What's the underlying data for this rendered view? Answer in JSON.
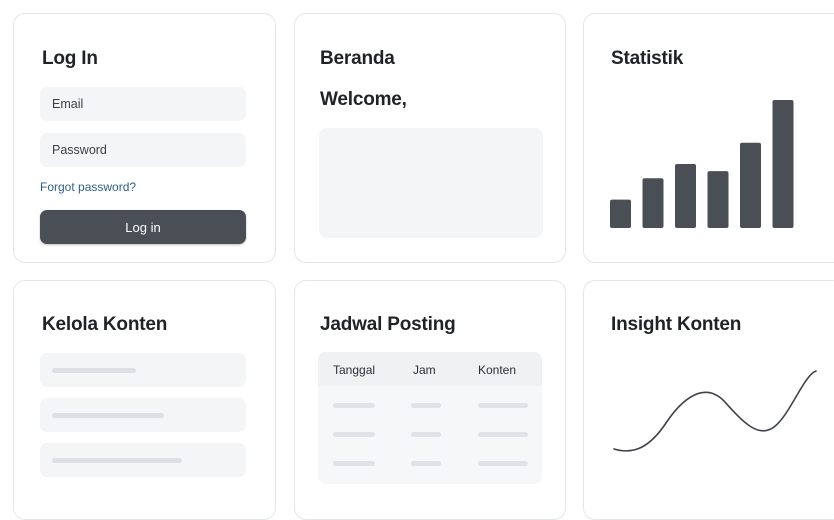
{
  "login": {
    "title": "Log In",
    "email_placeholder": "Email",
    "password_placeholder": "Password",
    "forgot_link": "Forgot password?",
    "submit_label": "Log in"
  },
  "home": {
    "title": "Beranda",
    "greeting": "Welcome,"
  },
  "stats": {
    "title": "Statistik",
    "chart_data": {
      "type": "bar",
      "values": [
        2,
        3.5,
        4.5,
        4,
        6,
        9
      ],
      "ylim": [
        0,
        9
      ],
      "bar_color": "#4a4f56"
    }
  },
  "content_manager": {
    "title": "Kelola Konten",
    "items": 3
  },
  "schedule": {
    "title": "Jadwal Posting",
    "columns": [
      "Tanggal",
      "Jam",
      "Konten"
    ]
  },
  "insight": {
    "title": "Insight Konten",
    "line_color": "#3f444a"
  },
  "colors": {
    "primary_button": "#4a4f56",
    "link": "#2f5f87",
    "field_bg": "#f4f5f7"
  }
}
